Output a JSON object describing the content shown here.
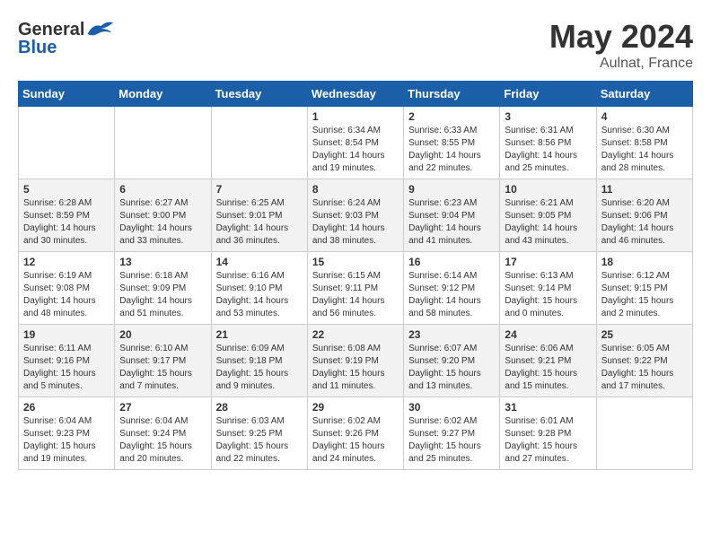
{
  "header": {
    "logo": "GeneralBlue",
    "title": "May 2024",
    "subtitle": "Aulnat, France"
  },
  "weekdays": [
    "Sunday",
    "Monday",
    "Tuesday",
    "Wednesday",
    "Thursday",
    "Friday",
    "Saturday"
  ],
  "weeks": [
    [
      {
        "day": "",
        "info": ""
      },
      {
        "day": "",
        "info": ""
      },
      {
        "day": "",
        "info": ""
      },
      {
        "day": "1",
        "info": "Sunrise: 6:34 AM\nSunset: 8:54 PM\nDaylight: 14 hours\nand 19 minutes."
      },
      {
        "day": "2",
        "info": "Sunrise: 6:33 AM\nSunset: 8:55 PM\nDaylight: 14 hours\nand 22 minutes."
      },
      {
        "day": "3",
        "info": "Sunrise: 6:31 AM\nSunset: 8:56 PM\nDaylight: 14 hours\nand 25 minutes."
      },
      {
        "day": "4",
        "info": "Sunrise: 6:30 AM\nSunset: 8:58 PM\nDaylight: 14 hours\nand 28 minutes."
      }
    ],
    [
      {
        "day": "5",
        "info": "Sunrise: 6:28 AM\nSunset: 8:59 PM\nDaylight: 14 hours\nand 30 minutes."
      },
      {
        "day": "6",
        "info": "Sunrise: 6:27 AM\nSunset: 9:00 PM\nDaylight: 14 hours\nand 33 minutes."
      },
      {
        "day": "7",
        "info": "Sunrise: 6:25 AM\nSunset: 9:01 PM\nDaylight: 14 hours\nand 36 minutes."
      },
      {
        "day": "8",
        "info": "Sunrise: 6:24 AM\nSunset: 9:03 PM\nDaylight: 14 hours\nand 38 minutes."
      },
      {
        "day": "9",
        "info": "Sunrise: 6:23 AM\nSunset: 9:04 PM\nDaylight: 14 hours\nand 41 minutes."
      },
      {
        "day": "10",
        "info": "Sunrise: 6:21 AM\nSunset: 9:05 PM\nDaylight: 14 hours\nand 43 minutes."
      },
      {
        "day": "11",
        "info": "Sunrise: 6:20 AM\nSunset: 9:06 PM\nDaylight: 14 hours\nand 46 minutes."
      }
    ],
    [
      {
        "day": "12",
        "info": "Sunrise: 6:19 AM\nSunset: 9:08 PM\nDaylight: 14 hours\nand 48 minutes."
      },
      {
        "day": "13",
        "info": "Sunrise: 6:18 AM\nSunset: 9:09 PM\nDaylight: 14 hours\nand 51 minutes."
      },
      {
        "day": "14",
        "info": "Sunrise: 6:16 AM\nSunset: 9:10 PM\nDaylight: 14 hours\nand 53 minutes."
      },
      {
        "day": "15",
        "info": "Sunrise: 6:15 AM\nSunset: 9:11 PM\nDaylight: 14 hours\nand 56 minutes."
      },
      {
        "day": "16",
        "info": "Sunrise: 6:14 AM\nSunset: 9:12 PM\nDaylight: 14 hours\nand 58 minutes."
      },
      {
        "day": "17",
        "info": "Sunrise: 6:13 AM\nSunset: 9:14 PM\nDaylight: 15 hours\nand 0 minutes."
      },
      {
        "day": "18",
        "info": "Sunrise: 6:12 AM\nSunset: 9:15 PM\nDaylight: 15 hours\nand 2 minutes."
      }
    ],
    [
      {
        "day": "19",
        "info": "Sunrise: 6:11 AM\nSunset: 9:16 PM\nDaylight: 15 hours\nand 5 minutes."
      },
      {
        "day": "20",
        "info": "Sunrise: 6:10 AM\nSunset: 9:17 PM\nDaylight: 15 hours\nand 7 minutes."
      },
      {
        "day": "21",
        "info": "Sunrise: 6:09 AM\nSunset: 9:18 PM\nDaylight: 15 hours\nand 9 minutes."
      },
      {
        "day": "22",
        "info": "Sunrise: 6:08 AM\nSunset: 9:19 PM\nDaylight: 15 hours\nand 11 minutes."
      },
      {
        "day": "23",
        "info": "Sunrise: 6:07 AM\nSunset: 9:20 PM\nDaylight: 15 hours\nand 13 minutes."
      },
      {
        "day": "24",
        "info": "Sunrise: 6:06 AM\nSunset: 9:21 PM\nDaylight: 15 hours\nand 15 minutes."
      },
      {
        "day": "25",
        "info": "Sunrise: 6:05 AM\nSunset: 9:22 PM\nDaylight: 15 hours\nand 17 minutes."
      }
    ],
    [
      {
        "day": "26",
        "info": "Sunrise: 6:04 AM\nSunset: 9:23 PM\nDaylight: 15 hours\nand 19 minutes."
      },
      {
        "day": "27",
        "info": "Sunrise: 6:04 AM\nSunset: 9:24 PM\nDaylight: 15 hours\nand 20 minutes."
      },
      {
        "day": "28",
        "info": "Sunrise: 6:03 AM\nSunset: 9:25 PM\nDaylight: 15 hours\nand 22 minutes."
      },
      {
        "day": "29",
        "info": "Sunrise: 6:02 AM\nSunset: 9:26 PM\nDaylight: 15 hours\nand 24 minutes."
      },
      {
        "day": "30",
        "info": "Sunrise: 6:02 AM\nSunset: 9:27 PM\nDaylight: 15 hours\nand 25 minutes."
      },
      {
        "day": "31",
        "info": "Sunrise: 6:01 AM\nSunset: 9:28 PM\nDaylight: 15 hours\nand 27 minutes."
      },
      {
        "day": "",
        "info": ""
      }
    ]
  ]
}
